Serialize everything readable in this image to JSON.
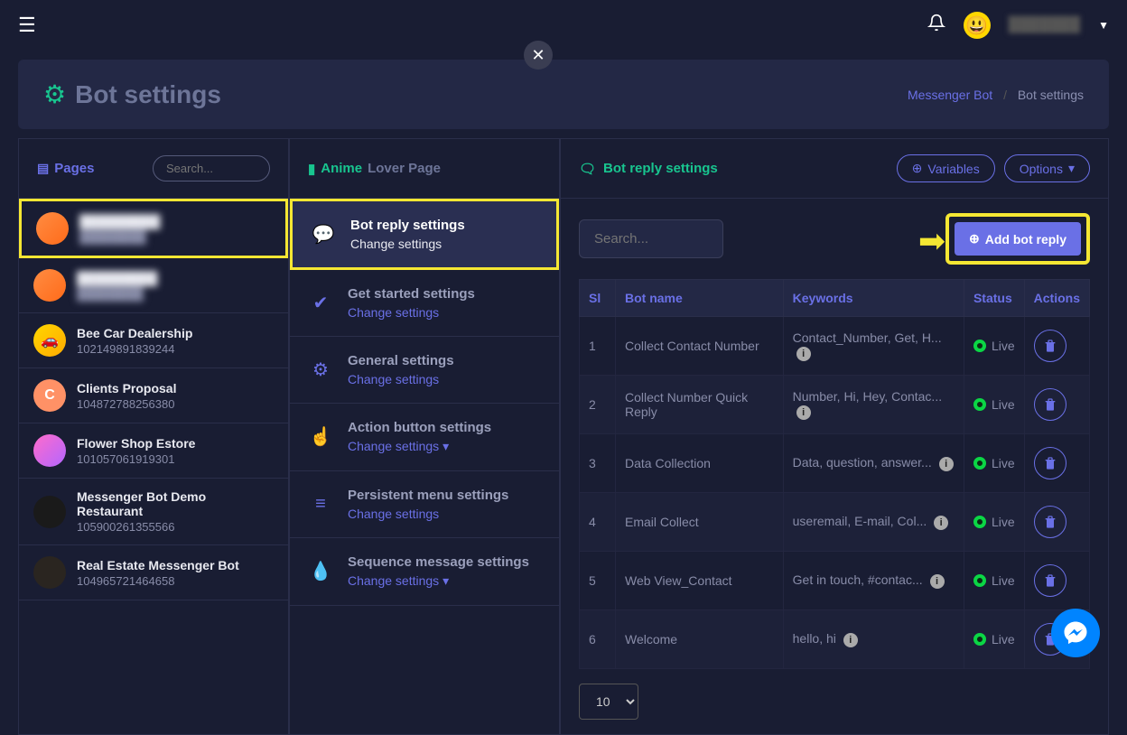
{
  "topbar": {
    "user": "███████"
  },
  "header": {
    "title": "Bot settings",
    "breadcrumb_link": "Messenger Bot",
    "breadcrumb_current": "Bot settings"
  },
  "pages_panel": {
    "label": "Pages",
    "search_placeholder": "Search...",
    "items": [
      {
        "name": "█████████",
        "id": "████████",
        "blurred": true,
        "highlighted": true,
        "avatar": "av-orange",
        "initial": ""
      },
      {
        "name": "█████████",
        "id": "████████",
        "blurred": true,
        "highlighted": false,
        "avatar": "av-orange",
        "initial": ""
      },
      {
        "name": "Bee Car Dealership",
        "id": "102149891839244",
        "blurred": false,
        "highlighted": false,
        "avatar": "av-yellow",
        "initial": "🚗"
      },
      {
        "name": "Clients Proposal",
        "id": "104872788256380",
        "blurred": false,
        "highlighted": false,
        "avatar": "av-c",
        "initial": "C"
      },
      {
        "name": "Flower Shop Estore",
        "id": "101057061919301",
        "blurred": false,
        "highlighted": false,
        "avatar": "av-flower",
        "initial": ""
      },
      {
        "name": "Messenger Bot Demo Restaurant",
        "id": "105900261355566",
        "blurred": false,
        "highlighted": false,
        "avatar": "av-rest",
        "initial": ""
      },
      {
        "name": "Real Estate Messenger Bot",
        "id": "104965721464658",
        "blurred": false,
        "highlighted": false,
        "avatar": "av-real",
        "initial": ""
      }
    ]
  },
  "settings_panel": {
    "fb_prefix": "Anime",
    "fb_suffix": "Lover Page",
    "items": [
      {
        "title": "Bot reply settings",
        "link": "Change settings",
        "icon": "💬",
        "highlighted": true,
        "caret": false
      },
      {
        "title": "Get started settings",
        "link": "Change settings",
        "icon": "✔",
        "highlighted": false,
        "caret": false
      },
      {
        "title": "General settings",
        "link": "Change settings",
        "icon": "⚙",
        "highlighted": false,
        "caret": false
      },
      {
        "title": "Action button settings",
        "link": "Change settings",
        "icon": "☝",
        "highlighted": false,
        "caret": true
      },
      {
        "title": "Persistent menu settings",
        "link": "Change settings",
        "icon": "≡",
        "highlighted": false,
        "caret": false
      },
      {
        "title": "Sequence message settings",
        "link": "Change settings",
        "icon": "💧",
        "highlighted": false,
        "caret": true
      }
    ]
  },
  "reply_panel": {
    "label": "Bot reply settings",
    "variables_btn": "Variables",
    "options_btn": "Options",
    "search_placeholder": "Search...",
    "add_btn": "Add bot reply",
    "headers": {
      "sl": "Sl",
      "name": "Bot name",
      "keywords": "Keywords",
      "status": "Status",
      "actions": "Actions"
    },
    "rows": [
      {
        "sl": "1",
        "name": "Collect Contact Number",
        "keywords": "Contact_Number, Get, H...",
        "status": "Live"
      },
      {
        "sl": "2",
        "name": "Collect Number Quick Reply",
        "keywords": "Number, Hi, Hey, Contac...",
        "status": "Live"
      },
      {
        "sl": "3",
        "name": "Data Collection",
        "keywords": "Data, question, answer...",
        "status": "Live"
      },
      {
        "sl": "4",
        "name": "Email Collect",
        "keywords": "useremail, E-mail, Col...",
        "status": "Live"
      },
      {
        "sl": "5",
        "name": "Web View_Contact",
        "keywords": "Get in touch, #contac...",
        "status": "Live"
      },
      {
        "sl": "6",
        "name": "Welcome",
        "keywords": "hello, hi",
        "status": "Live"
      }
    ],
    "page_size": "10"
  }
}
